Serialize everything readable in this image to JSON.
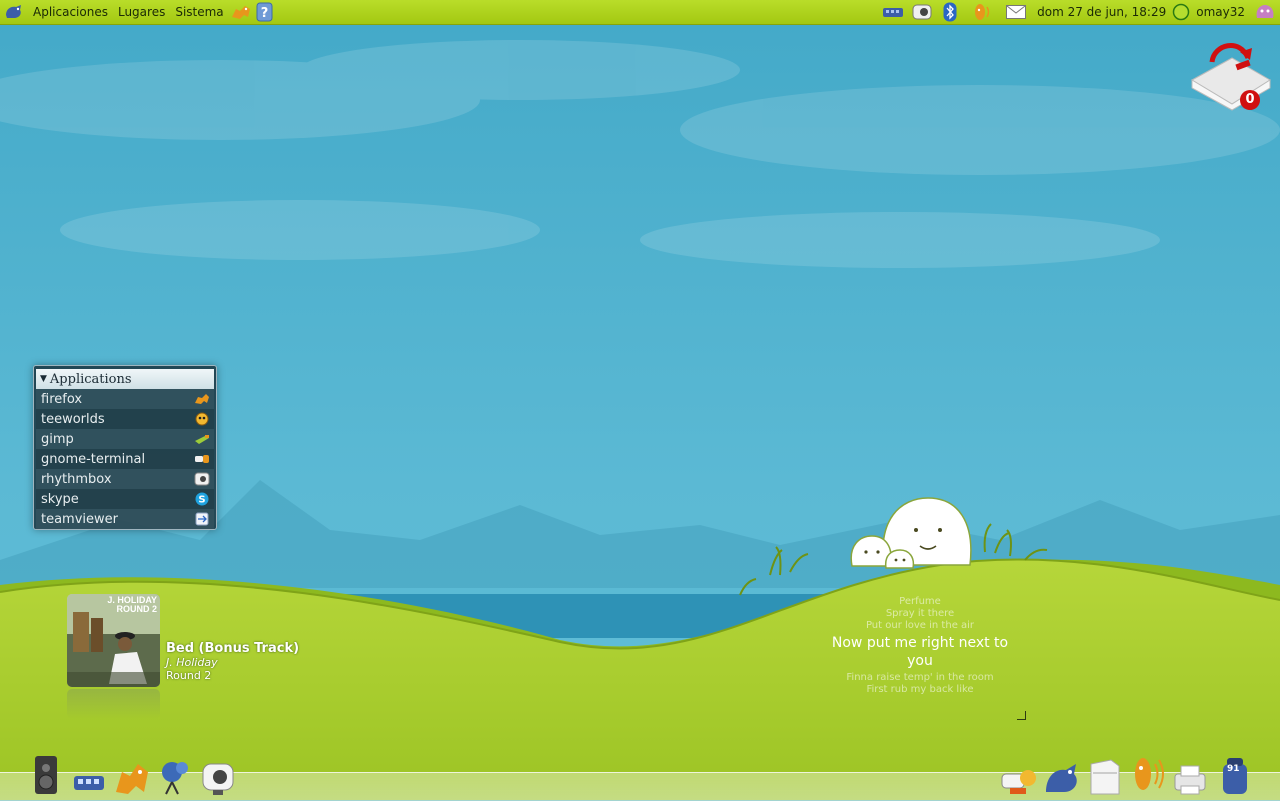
{
  "top_panel": {
    "menus": [
      "Aplicaciones",
      "Lugares",
      "Sistema"
    ],
    "clock": "dom 27 de jun, 18:29",
    "user": "omay32"
  },
  "apps_widget": {
    "title": "Applications",
    "items": [
      {
        "label": "firefox",
        "icon": "firefox-icon"
      },
      {
        "label": "teeworlds",
        "icon": "teeworlds-icon"
      },
      {
        "label": "gimp",
        "icon": "gimp-icon"
      },
      {
        "label": "gnome-terminal",
        "icon": "terminal-icon"
      },
      {
        "label": "rhythmbox",
        "icon": "rhythmbox-icon"
      },
      {
        "label": "skype",
        "icon": "skype-icon"
      },
      {
        "label": "teamviewer",
        "icon": "teamviewer-icon"
      }
    ]
  },
  "music": {
    "album_art_text": "J. HOLIDAY ROUND 2",
    "title": "Bed (Bonus Track)",
    "artist": "J. Holiday",
    "album": "Round 2"
  },
  "lyrics": {
    "before": [
      "Perfume",
      "Spray it there",
      "Put our love in the air"
    ],
    "current": "Now put me right next to you",
    "after": [
      "Finna raise temp' in the room",
      "First rub my back like"
    ]
  },
  "mail": {
    "count": "0"
  },
  "dock": {
    "trash_count": "91"
  },
  "colors": {
    "panel": "#aed21c",
    "sky": "#4fb3cf",
    "hill": "#a6cc2e",
    "mail_badge": "#d01010"
  }
}
